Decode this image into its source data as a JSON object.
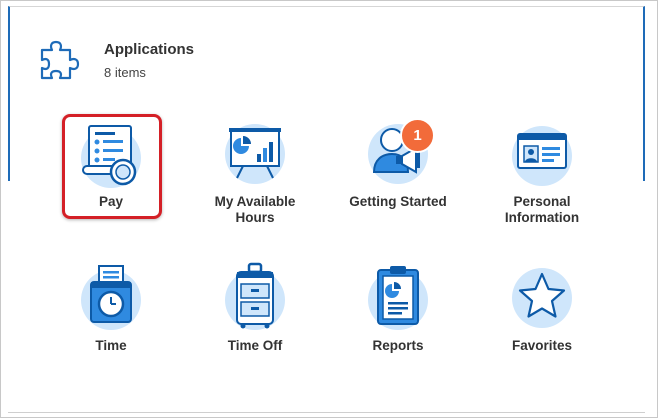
{
  "header": {
    "title": "Applications",
    "count": "8 items",
    "icon": "puzzle-icon"
  },
  "colors": {
    "accent": "#1e6bb8",
    "icon_fill": "#cfe6fb",
    "icon_dark": "#0d5aa7",
    "highlight": "#d42027",
    "badge": "#f26b3a"
  },
  "apps": [
    {
      "label": "Pay",
      "icon": "pay-icon"
    },
    {
      "label": "My Available Hours",
      "icon": "presentation-chart-icon"
    },
    {
      "label": "Getting Started",
      "icon": "person-megaphone-icon",
      "badge": "1"
    },
    {
      "label": "Personal Information",
      "icon": "id-card-icon"
    },
    {
      "label": "Time",
      "icon": "time-clock-icon"
    },
    {
      "label": "Time Off",
      "icon": "suitcase-icon"
    },
    {
      "label": "Reports",
      "icon": "clipboard-report-icon"
    },
    {
      "label": "Favorites",
      "icon": "star-icon"
    }
  ]
}
